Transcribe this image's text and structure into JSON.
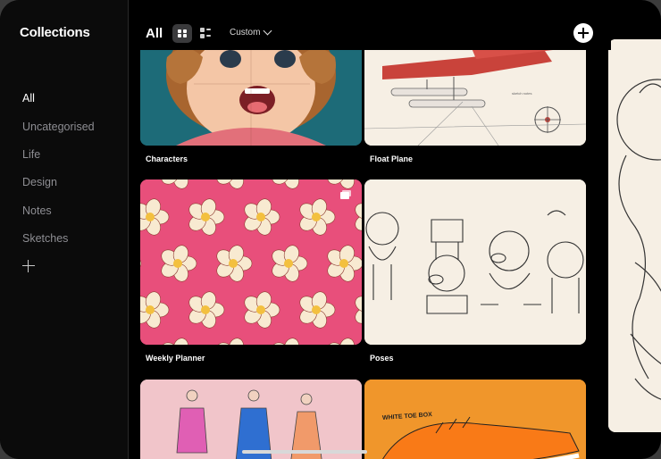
{
  "sidebar": {
    "title": "Collections",
    "items": [
      {
        "label": "All",
        "active": true
      },
      {
        "label": "Uncategorised",
        "active": false
      },
      {
        "label": "Life",
        "active": false
      },
      {
        "label": "Design",
        "active": false
      },
      {
        "label": "Notes",
        "active": false
      },
      {
        "label": "Sketches",
        "active": false
      }
    ],
    "add_icon": "plus-icon"
  },
  "header": {
    "title": "All",
    "view_modes": [
      "grid-view-icon",
      "list-view-icon"
    ],
    "sort_label": "Custom",
    "add_icon": "plus-circle-icon"
  },
  "cards": [
    {
      "label": "Characters"
    },
    {
      "label": "Float Plane"
    },
    {
      "label": "Weekly Planner"
    },
    {
      "label": "Poses"
    },
    {
      "label": "",
      "id": "fashion"
    },
    {
      "label": "",
      "id": "shoe"
    }
  ],
  "thumbnail_text": {
    "shoe_note": "WHITE TOE BOX"
  },
  "colors": {
    "background": "#000000",
    "sidebar": "#0b0b0b",
    "accent_pink": "#e84f7b",
    "paper": "#f6efe4",
    "teal": "#1f6f7c",
    "orange": "#f08a22"
  }
}
